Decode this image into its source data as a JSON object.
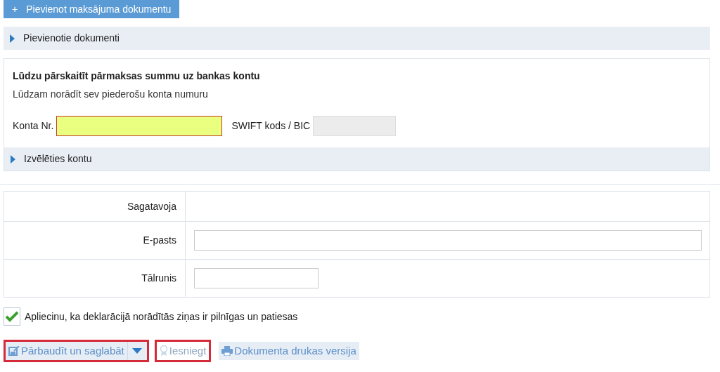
{
  "add_button": {
    "label": "Pievienot maksājuma dokumentu",
    "icon": "+"
  },
  "attached_section": {
    "label": "Pievienotie dokumenti",
    "expanded": false
  },
  "bank_card": {
    "title": "Lūdzu pārskaitīt pārmaksas summu uz bankas kontu",
    "subtitle": "Lūdzam norādīt sev piederošu konta numuru",
    "fields": [
      {
        "label": "Konta Nr.",
        "kind": "required"
      },
      {
        "label": "SWIFT kods / BIC",
        "kind": "disabled"
      }
    ],
    "choose_section": {
      "label": "Izvēlēties kontu",
      "expanded": false
    }
  },
  "form_rows": [
    {
      "label": "Sagatavoja",
      "kind": "text"
    },
    {
      "label": "E-pasts",
      "kind": "wide"
    },
    {
      "label": "Tālrunis",
      "kind": "short"
    }
  ],
  "confirm": {
    "label": "Apliecinu, ka deklarācijā norādītās ziņas ir pilnīgas un patiesas",
    "checked": true
  },
  "buttons": [
    {
      "label": "Pārbaudīt un saglabāt",
      "kind": "save",
      "highlighted": true,
      "disabled": false
    },
    {
      "label": "Iesniegt",
      "kind": "submit",
      "highlighted": true,
      "disabled": true
    },
    {
      "label": "Dokumenta drukas versija",
      "kind": "print",
      "highlighted": false,
      "disabled": false
    }
  ]
}
